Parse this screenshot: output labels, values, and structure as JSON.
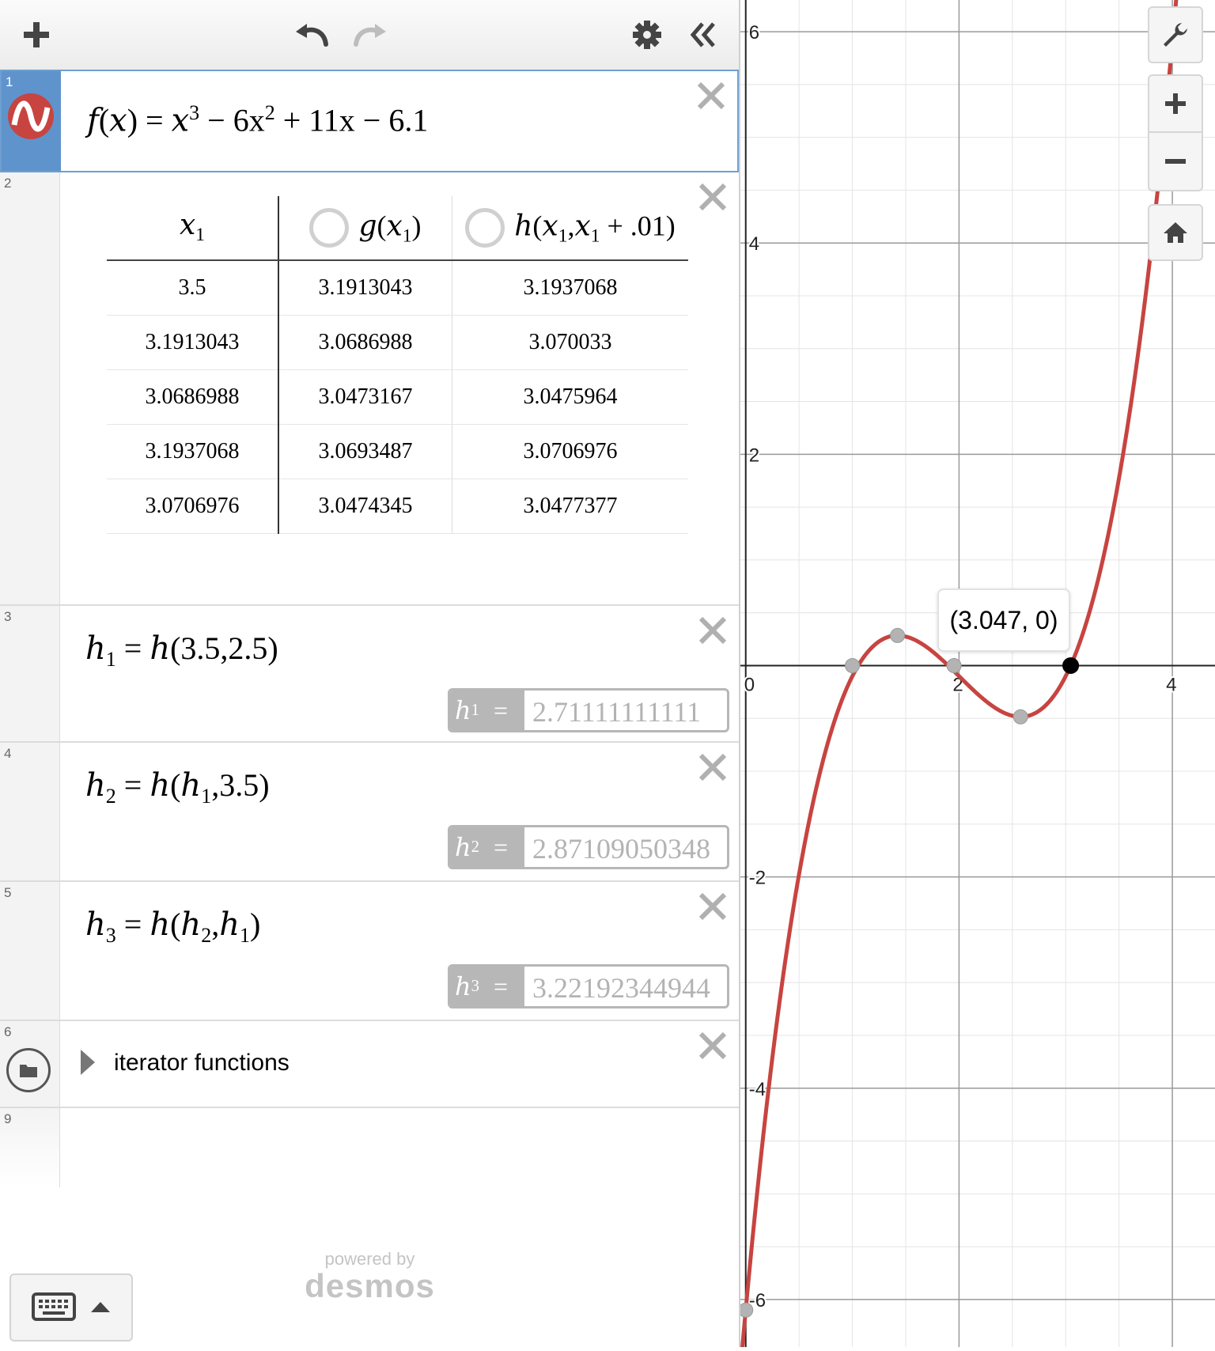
{
  "toolbar": {
    "add_icon": "plus-icon",
    "undo_icon": "undo-icon",
    "redo_icon": "redo-icon",
    "settings_icon": "gear-icon",
    "collapse_icon": "double-chevron-left-icon"
  },
  "expressions": [
    {
      "index": "1",
      "lhs": "f",
      "arg": "x",
      "rhs_parts": [
        "x",
        "3",
        " − 6x",
        "2",
        " + 11x − 6.1"
      ],
      "color": "#c74440"
    },
    {
      "index": "2",
      "table": {
        "headers": [
          {
            "base": "x",
            "sub": "1"
          },
          {
            "fn": "g",
            "arg": "x",
            "sub": "1"
          },
          {
            "fn": "h",
            "arg": "x",
            "sub": "1",
            "arg2": "x",
            "sub2": "1",
            "tail": " + .01"
          }
        ],
        "rows": [
          [
            "3.5",
            "3.1913043",
            "3.1937068"
          ],
          [
            "3.1913043",
            "3.0686988",
            "3.070033"
          ],
          [
            "3.0686988",
            "3.0473167",
            "3.0475964"
          ],
          [
            "3.1937068",
            "3.0693487",
            "3.0706976"
          ],
          [
            "3.0706976",
            "3.0474345",
            "3.0477377"
          ]
        ]
      }
    },
    {
      "index": "3",
      "name": "h",
      "sub": "1",
      "arg1": "3.5",
      "arg2": "2.5",
      "value_label": "h",
      "value_sub": "1",
      "value": "2.71111111111"
    },
    {
      "index": "4",
      "name": "h",
      "sub": "2",
      "arg1": "h",
      "arg1_sub": "1",
      "arg2": "3.5",
      "value_label": "h",
      "value_sub": "2",
      "value": "2.87109050348"
    },
    {
      "index": "5",
      "name": "h",
      "sub": "3",
      "arg1": "h",
      "arg1_sub": "2",
      "arg2": "h",
      "arg2_sub": "1",
      "value_label": "h",
      "value_sub": "3",
      "value": "3.22192344944"
    },
    {
      "index": "6",
      "folder_label": "iterator functions",
      "folder_icon": "folder-icon"
    },
    {
      "index": "9"
    }
  ],
  "footer": {
    "powered_by": "powered by",
    "brand": "desmos",
    "keyboard_icon": "keyboard-icon"
  },
  "graph": {
    "x_ticks": [
      "0",
      "2",
      "4"
    ],
    "y_ticks": [
      "6",
      "4",
      "2",
      "-2",
      "-4",
      "-6"
    ],
    "x_range": [
      -0.05,
      4.4
    ],
    "y_range": [
      -6.45,
      6.3
    ],
    "curve_color": "#c74440",
    "tooltip": "(3.047, 0)",
    "points": [
      {
        "x": 1.0,
        "y": 0,
        "kind": "gray"
      },
      {
        "x": 1.423,
        "y": 0.285,
        "kind": "gray"
      },
      {
        "x": 1.953,
        "y": 0,
        "kind": "gray"
      },
      {
        "x": 2.577,
        "y": -0.485,
        "kind": "gray"
      },
      {
        "x": 0,
        "y": -6.1,
        "kind": "gray"
      },
      {
        "x": 3.047,
        "y": 0,
        "kind": "black"
      }
    ],
    "tools": [
      "wrench-icon",
      "zoom-in-icon",
      "zoom-out-icon",
      "home-icon"
    ]
  }
}
